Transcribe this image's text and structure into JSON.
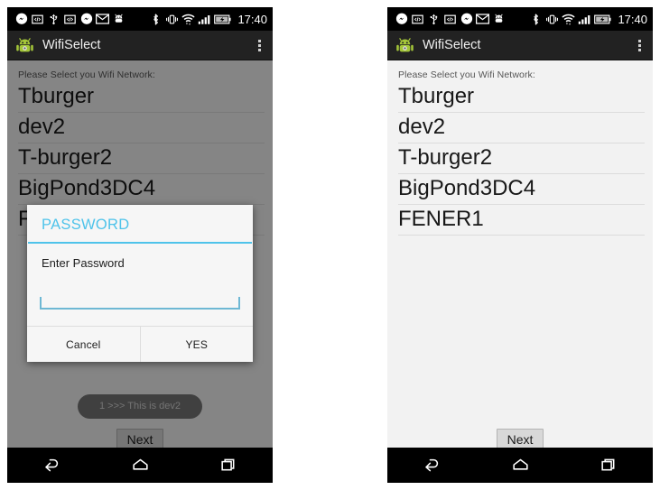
{
  "statusbar": {
    "icons": [
      "messenger-icon",
      "developer-mode-icon",
      "usb-icon",
      "developer-mode-icon-2",
      "messenger-icon-2",
      "email-icon",
      "android-debug-icon"
    ],
    "right_icons": [
      "bluetooth-icon",
      "vibrate-icon",
      "wifi-icon",
      "signal-bars-icon",
      "battery-charging-icon"
    ],
    "time": "17:40"
  },
  "actionbar": {
    "app_icon": "android-robot-icon",
    "title": "WifiSelect",
    "overflow": "overflow-menu-icon"
  },
  "content": {
    "hint": "Please Select you Wifi Network:",
    "networks": [
      "Tburger",
      "dev2",
      "T-burger2",
      "BigPond3DC4",
      "FENER1"
    ],
    "next_label": "Next",
    "toast": "1 >>> This is dev2"
  },
  "dialog": {
    "title": "PASSWORD",
    "message": "Enter Password",
    "input_value": "",
    "input_placeholder": "",
    "cancel_label": "Cancel",
    "confirm_label": "YES"
  },
  "navbar": {
    "back": "back-icon",
    "home": "home-icon",
    "recents": "recent-apps-icon"
  },
  "colors": {
    "accent": "#4ec3ea",
    "statusbar_bg": "#000000",
    "actionbar_bg": "#222222",
    "content_bg": "#f2f2f2",
    "dialog_bg": "#f6f6f6"
  }
}
